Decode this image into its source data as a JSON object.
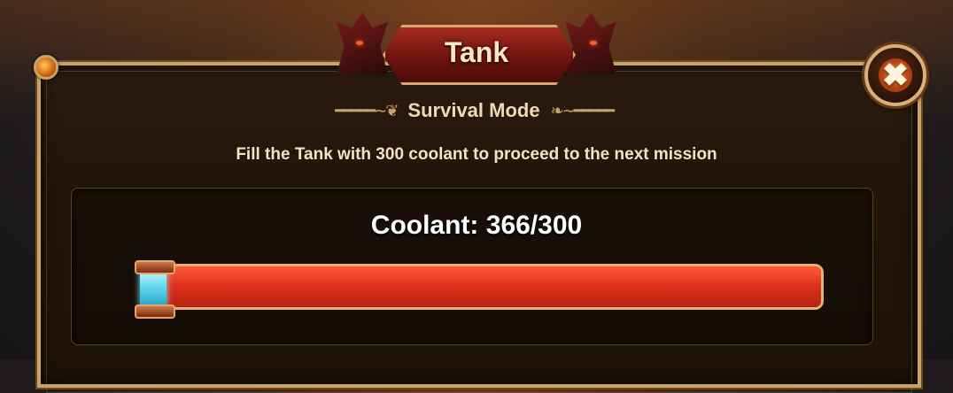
{
  "dialog": {
    "title": "Tank",
    "subtitle": "Survival Mode",
    "description": "Fill the Tank with 300 coolant to proceed to the next mission"
  },
  "coolant": {
    "label": "Coolant: 366/300",
    "current": 366,
    "required": 300,
    "fill_fraction": 1.0,
    "icon": "coolant-vial-icon"
  },
  "close": {
    "icon": "close-icon"
  },
  "colors": {
    "bar_fill": "#e0321e",
    "frame_gold": "#c9a46a",
    "banner_red": "#a52a1e",
    "text_cream": "#f3e2c4"
  }
}
